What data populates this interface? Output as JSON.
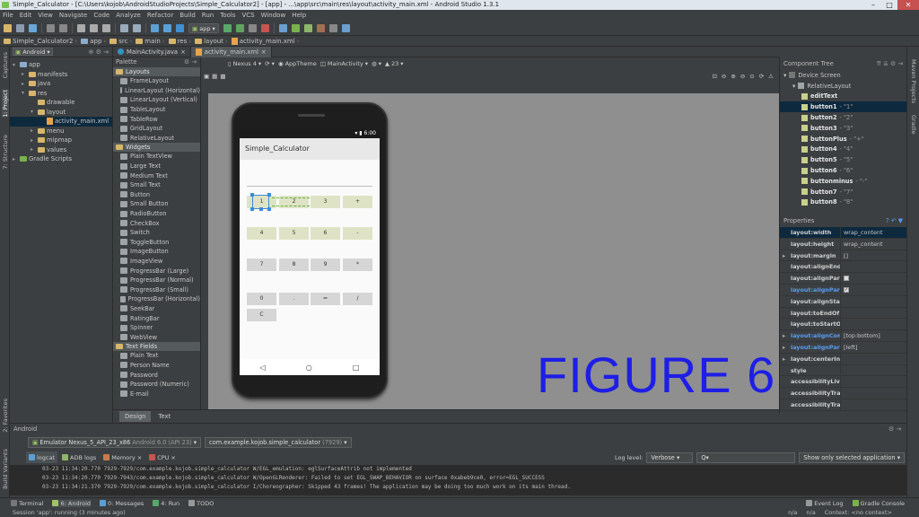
{
  "window": {
    "title": "Simple_Calculator - [C:\\Users\\kojob\\AndroidStudioProjects\\Simple_Calculator2] - [app] - ...\\app\\src\\main\\res\\layout\\activity_main.xml - Android Studio 1.3.1"
  },
  "menu": [
    "File",
    "Edit",
    "View",
    "Navigate",
    "Code",
    "Analyze",
    "Refactor",
    "Build",
    "Run",
    "Tools",
    "VCS",
    "Window",
    "Help"
  ],
  "toolbar": {
    "run_config": "app"
  },
  "breadcrumbs": [
    "Simple_Calculator2",
    "app",
    "src",
    "main",
    "res",
    "layout",
    "activity_main.xml"
  ],
  "project_view": {
    "mode": "Android",
    "tree": [
      {
        "label": "app",
        "depth": 0,
        "arrow": "▾"
      },
      {
        "label": "manifests",
        "depth": 1,
        "arrow": "▸"
      },
      {
        "label": "java",
        "depth": 1,
        "arrow": "▸"
      },
      {
        "label": "res",
        "depth": 1,
        "arrow": "▾"
      },
      {
        "label": "drawable",
        "depth": 2,
        "arrow": ""
      },
      {
        "label": "layout",
        "depth": 2,
        "arrow": "▾"
      },
      {
        "label": "activity_main.xml",
        "depth": 3,
        "arrow": ""
      },
      {
        "label": "menu",
        "depth": 2,
        "arrow": "▸"
      },
      {
        "label": "mipmap",
        "depth": 2,
        "arrow": "▸"
      },
      {
        "label": "values",
        "depth": 2,
        "arrow": "▸"
      },
      {
        "label": "Gradle Scripts",
        "depth": 0,
        "arrow": "▸"
      }
    ]
  },
  "left_strip": {
    "captures": "Captures",
    "project": "1: Project",
    "structure": "7: Structure",
    "favorites": "2: Favorites",
    "build_variants": "Build Variants"
  },
  "editor_tabs": [
    "MainActivity.java",
    "activity_main.xml"
  ],
  "palette": {
    "title": "Palette",
    "groups": [
      {
        "name": "Layouts",
        "items": [
          "FrameLayout",
          "LinearLayout (Horizontal)",
          "LinearLayout (Vertical)",
          "TableLayout",
          "TableRow",
          "GridLayout",
          "RelativeLayout"
        ]
      },
      {
        "name": "Widgets",
        "items": [
          "Plain TextView",
          "Large Text",
          "Medium Text",
          "Small Text",
          "Button",
          "Small Button",
          "RadioButton",
          "CheckBox",
          "Switch",
          "ToggleButton",
          "ImageButton",
          "ImageView",
          "ProgressBar (Large)",
          "ProgressBar (Normal)",
          "ProgressBar (Small)",
          "ProgressBar (Horizontal)",
          "SeekBar",
          "RatingBar",
          "Spinner",
          "WebView"
        ]
      },
      {
        "name": "Text Fields",
        "items": [
          "Plain Text",
          "Person Name",
          "Password",
          "Password (Numeric)",
          "E-mail"
        ]
      }
    ]
  },
  "design_toolbar": {
    "device": "Nexus 4",
    "theme": "AppTheme",
    "activity": "MainActivity",
    "api": "23"
  },
  "phone": {
    "status_time": "6:00",
    "app_title": "Simple_Calculator",
    "buttons": [
      [
        "1",
        "2",
        "3",
        "+"
      ],
      [
        "4",
        "5",
        "6",
        "-"
      ],
      [
        "7",
        "8",
        "9",
        "*"
      ],
      [
        "0",
        ".",
        "=",
        "/"
      ],
      [
        "C"
      ]
    ],
    "nav": [
      "◁",
      "○",
      "□"
    ]
  },
  "figure_label": "FIGURE 6",
  "design_tabs": [
    "Design",
    "Text"
  ],
  "component_tree": {
    "title": "Component Tree",
    "items": [
      {
        "label": "Device Screen",
        "depth": 0,
        "note": ""
      },
      {
        "label": "RelativeLayout",
        "depth": 1,
        "note": ""
      },
      {
        "label": "editText",
        "depth": 2,
        "note": ""
      },
      {
        "label": "button1",
        "depth": 2,
        "note": "- \"1\""
      },
      {
        "label": "button2",
        "depth": 2,
        "note": "- \"2\""
      },
      {
        "label": "button3",
        "depth": 2,
        "note": "- \"3\""
      },
      {
        "label": "buttonPlus",
        "depth": 2,
        "note": "- \"+\""
      },
      {
        "label": "button4",
        "depth": 2,
        "note": "- \"4\""
      },
      {
        "label": "button5",
        "depth": 2,
        "note": "- \"5\""
      },
      {
        "label": "button6",
        "depth": 2,
        "note": "- \"6\""
      },
      {
        "label": "buttonminus",
        "depth": 2,
        "note": "- \"-\""
      },
      {
        "label": "button7",
        "depth": 2,
        "note": "- \"7\""
      },
      {
        "label": "button8",
        "depth": 2,
        "note": "- \"8\""
      }
    ]
  },
  "properties": {
    "title": "Properties",
    "rows": [
      {
        "key": "layout:width",
        "value": "wrap_content",
        "blue": false,
        "arrow": false
      },
      {
        "key": "layout:height",
        "value": "wrap_content",
        "blue": false,
        "arrow": false
      },
      {
        "key": "layout:margin",
        "value": "[]",
        "blue": false,
        "arrow": true
      },
      {
        "key": "layout:alignEnd",
        "value": "",
        "blue": false,
        "arrow": false
      },
      {
        "key": "layout:alignParentE",
        "value": "",
        "blue": false,
        "arrow": false,
        "checkbox": "off"
      },
      {
        "key": "layout:alignParentS",
        "value": "",
        "blue": true,
        "arrow": false,
        "checkbox": "on"
      },
      {
        "key": "layout:alignStart",
        "value": "",
        "blue": false,
        "arrow": false
      },
      {
        "key": "layout:toEndOf",
        "value": "",
        "blue": false,
        "arrow": false
      },
      {
        "key": "layout:toStartOf",
        "value": "",
        "blue": false,
        "arrow": false
      },
      {
        "key": "layout:alignCompor",
        "value": "[top:bottom]",
        "blue": true,
        "arrow": true
      },
      {
        "key": "layout:alignParent",
        "value": "[left]",
        "blue": true,
        "arrow": true
      },
      {
        "key": "layout:centerInPare",
        "value": "",
        "blue": false,
        "arrow": true
      },
      {
        "key": "style",
        "value": "",
        "blue": false,
        "arrow": false
      },
      {
        "key": "accessibilityLiveRegi",
        "value": "",
        "blue": false,
        "arrow": false
      },
      {
        "key": "accessibilityTraversa",
        "value": "",
        "blue": false,
        "arrow": false
      },
      {
        "key": "accessibilityTraversa",
        "value": "",
        "blue": false,
        "arrow": false
      }
    ]
  },
  "right_strip": {
    "maven": "Maven Projects",
    "gradle": "Gradle"
  },
  "android_monitor": {
    "title": "Android",
    "device": "Emulator Nexus_5_API_23_x86",
    "device_api": "Android 6.0 (API 23)",
    "process": "com.example.kojob.simple_calculator",
    "process_pid": "(7929)",
    "tabs": [
      "logcat",
      "ADB logs",
      "Memory",
      "CPU"
    ],
    "log_level_label": "Log level:",
    "log_level": "Verbose",
    "search_placeholder": "Q▾",
    "filter": "Show only selected application",
    "lines": [
      "03-23 11:34:20.770   7929-7929/com.example.kojob.simple_calculator W/EGL_emulation: eglSurfaceAttrib not implemented",
      "03-23 11:34:20.770   7929-7943/com.example.kojob.simple_calculator W/OpenGLRenderer: Failed to set EGL_SWAP_BEHAVIOR on surface 0xabeb9ce0, error=EGL_SUCCESS",
      "03-23 11:34:21.370   7929-7929/com.example.kojob.simple_calculator I/Choreographer: Skipped 43 frames!  The application may be doing too much work on its main thread."
    ]
  },
  "bottom_tabs": [
    "Terminal",
    "6: Android",
    "0: Messages",
    "4: Run",
    "TODO"
  ],
  "bottom_right_tabs": [
    "Event Log",
    "Gradle Console"
  ],
  "status": {
    "message": "Session 'app': running (3 minutes ago)",
    "na1": "n/a",
    "na2": "n/a",
    "context": "Context: <no context>"
  },
  "colors": {
    "accent": "#0d293e",
    "figure": "#1e1ee6",
    "link": "#589df6"
  }
}
